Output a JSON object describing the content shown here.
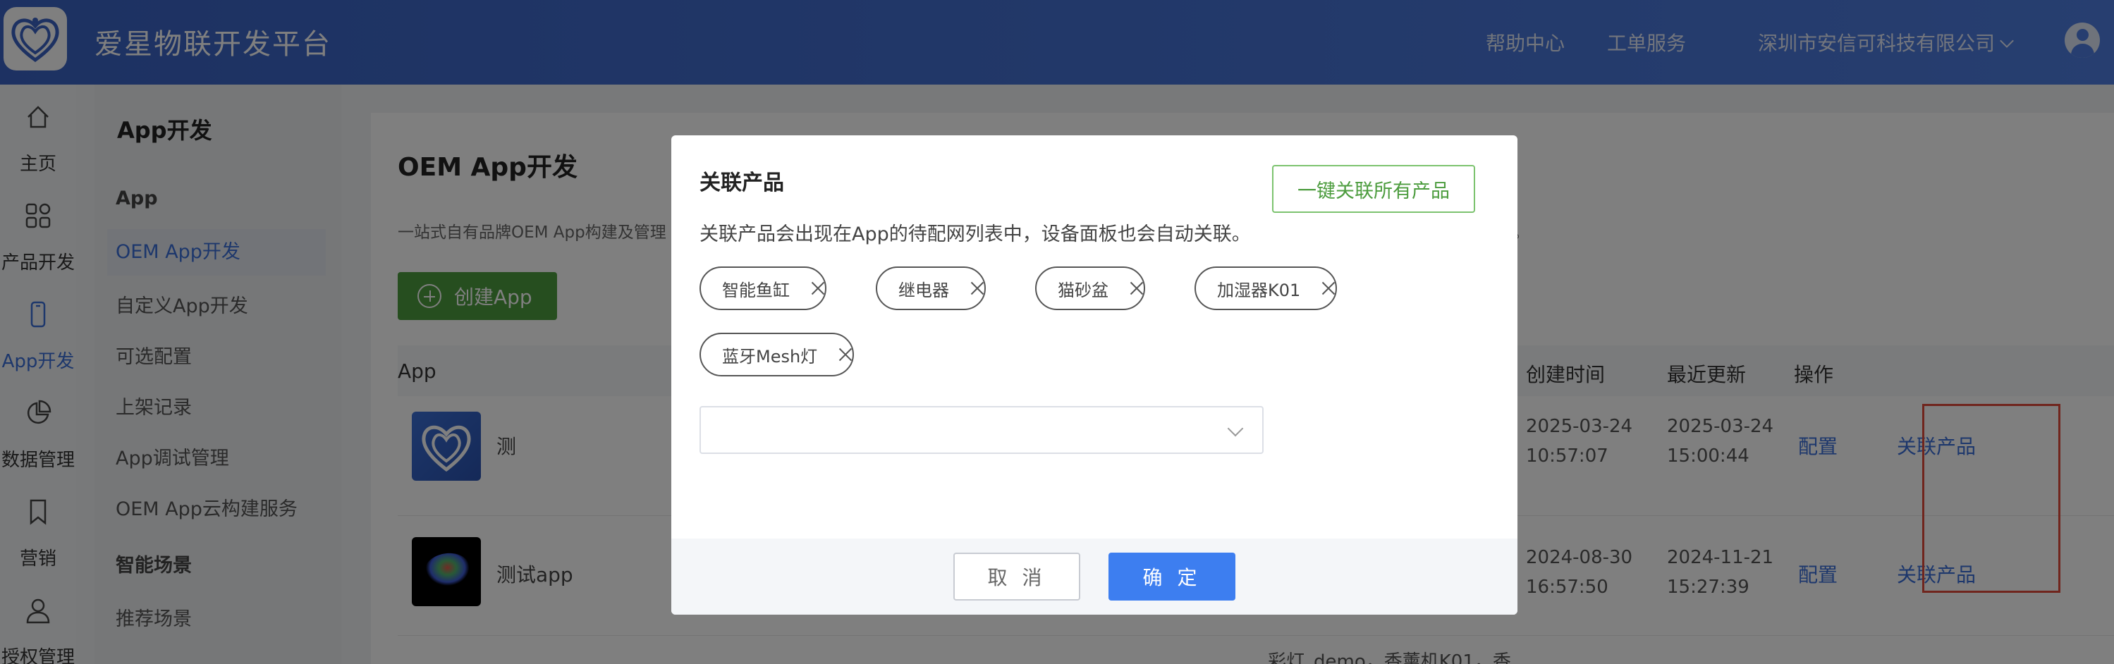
{
  "header": {
    "title": "爱星物联开发平台",
    "help": "帮助中心",
    "tickets": "工单服务",
    "company": "深圳市安信可科技有限公司"
  },
  "rail": [
    {
      "label": "主页",
      "icon": "home-icon"
    },
    {
      "label": "产品开发",
      "icon": "grid-icon"
    },
    {
      "label": "App开发",
      "icon": "phone-icon"
    },
    {
      "label": "数据管理",
      "icon": "pie-chart-icon"
    },
    {
      "label": "营销",
      "icon": "bookmark-icon"
    },
    {
      "label": "授权管理",
      "icon": "user-icon"
    }
  ],
  "subnav": {
    "title": "App开发",
    "group_app": "App",
    "items": [
      "OEM App开发",
      "自定义App开发",
      "可选配置",
      "上架记录",
      "App调试管理",
      "OEM App云构建服务"
    ],
    "group_scene": "智能场景",
    "scene_items": [
      "推荐场景"
    ]
  },
  "main": {
    "title": "OEM App开发",
    "desc_start": "一站式自有品牌OEM App构建及管理",
    "desc_end": "务。",
    "create_label": "创建App",
    "columns": {
      "app": "App",
      "created": "创建时间",
      "updated": "最近更新",
      "actions": "操作"
    },
    "rows": [
      {
        "name": "测",
        "created_date": "2025-03-24",
        "created_time": "10:57:07",
        "updated_date": "2025-03-24",
        "updated_time": "15:00:44",
        "config": "配置",
        "link": "关联产品"
      },
      {
        "name": "测试app",
        "created_date": "2024-08-30",
        "created_time": "16:57:50",
        "updated_date": "2024-11-21",
        "updated_time": "15:27:39",
        "config": "配置",
        "link": "关联产品"
      }
    ],
    "partial_products": "彩灯_demo，香薰机K01，香"
  },
  "modal": {
    "title": "关联产品",
    "link_all": "一键关联所有产品",
    "desc": "关联产品会出现在App的待配网列表中，设备面板也会自动关联。",
    "tags": [
      "智能鱼缸",
      "继电器",
      "猫砂盆",
      "加湿器K01",
      "蓝牙Mesh灯"
    ],
    "select_value": "",
    "cancel": "取 消",
    "confirm": "确 定"
  },
  "colors": {
    "brand": "#3a63c4",
    "accent": "#3d7ef0",
    "green": "#4c9c3e",
    "highlight": "#e04a3a"
  }
}
